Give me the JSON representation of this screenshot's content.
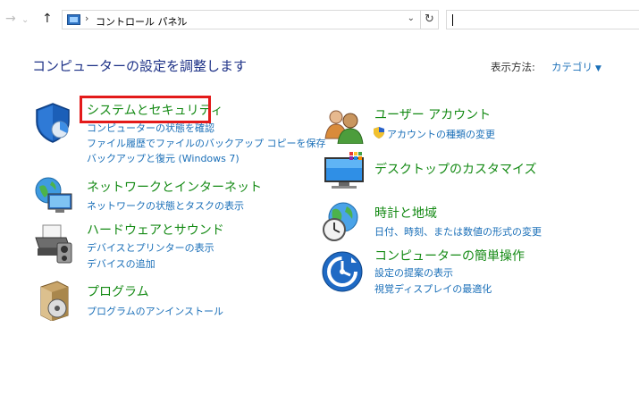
{
  "nav": {
    "back_icon": "back-arrow-icon",
    "forward_icon": "forward-arrow-icon",
    "up_icon": "up-arrow-icon"
  },
  "address": {
    "separator": "›",
    "breadcrumb": "コントロール パネル",
    "trailing_separator": "›"
  },
  "search": {
    "value": ""
  },
  "header": {
    "title": "コンピューターの設定を調整します",
    "view_by_label": "表示方法:",
    "view_by_value": "カテゴリ"
  },
  "categories": [
    {
      "title": "システムとセキュリティ",
      "icon": "shield-icon",
      "links": [
        "コンピューターの状態を確認",
        "ファイル履歴でファイルのバックアップ コピーを保存",
        "バックアップと復元 (Windows 7)"
      ]
    },
    {
      "title": "ネットワークとインターネット",
      "icon": "network-globe-icon",
      "links": [
        "ネットワークの状態とタスクの表示"
      ]
    },
    {
      "title": "ハードウェアとサウンド",
      "icon": "printer-icon",
      "links": [
        "デバイスとプリンターの表示",
        "デバイスの追加"
      ]
    },
    {
      "title": "プログラム",
      "icon": "programs-icon",
      "links": [
        "プログラムのアンインストール"
      ]
    },
    {
      "title": "ユーザー アカウント",
      "icon": "user-accounts-icon",
      "links": [
        "アカウントの種類の変更"
      ]
    },
    {
      "title": "デスクトップのカスタマイズ",
      "icon": "display-icon",
      "links": []
    },
    {
      "title": "時計と地域",
      "icon": "clock-globe-icon",
      "links": [
        "日付、時刻、または数値の形式の変更"
      ]
    },
    {
      "title": "コンピューターの簡単操作",
      "icon": "ease-of-access-icon",
      "links": [
        "設定の提案の表示",
        "視覚ディスプレイの最適化"
      ]
    }
  ],
  "colors": {
    "category_title": "#148a14",
    "link": "#1a6fb8",
    "heading": "#1e3287",
    "highlight_box": "#e31a1a"
  }
}
